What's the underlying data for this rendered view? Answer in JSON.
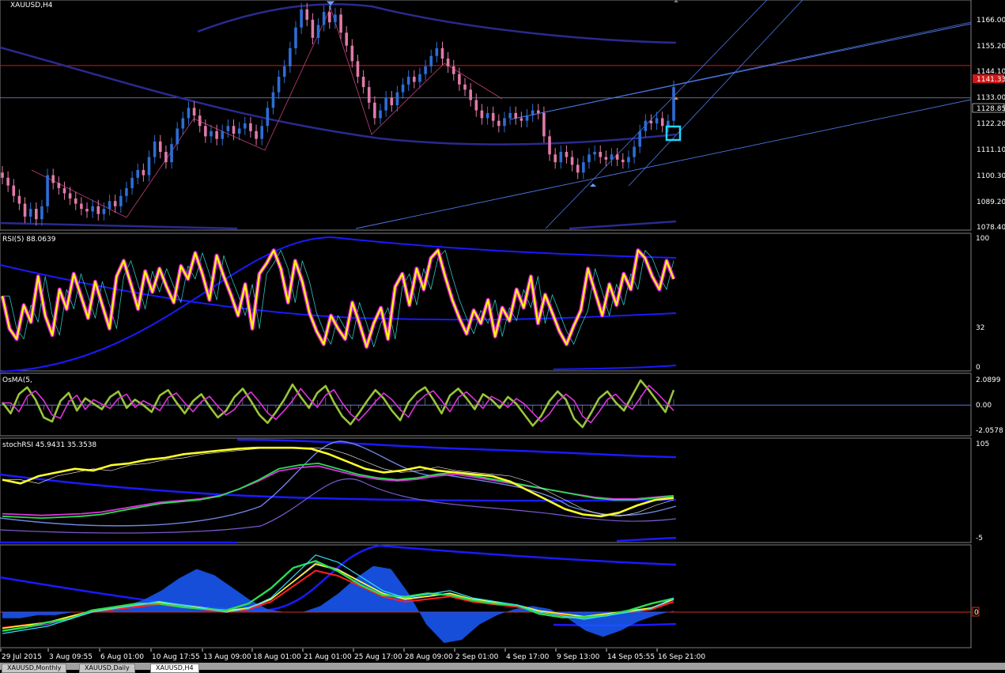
{
  "window": {
    "symbol_title": "XAUUSD,H4",
    "tabs": [
      {
        "label": "XAUUSD,Monthly",
        "active": false
      },
      {
        "label": "XAUUSD,Daily",
        "active": false
      },
      {
        "label": "XAUUSD,H4",
        "active": true
      }
    ]
  },
  "colors": {
    "up_candle": "#2d6dd6",
    "down_candle": "#e07aa8",
    "envelope": "#2a2a8f",
    "hline": "#d01818",
    "channel": "#4d78e8",
    "rsi_main": "#ffff00",
    "rsi_glow": "#e01ee0",
    "osma": "#9ac33a",
    "stoch_yellow": "#ffff2a",
    "stoch_green": "#2adc50",
    "stoch_magenta": "#dd33dd",
    "blue_band": "#1a1aff",
    "hist_blue": "#1a5aff",
    "cyan": "#30e0ff",
    "red": "#ff2020",
    "highlight_box": "#22d8ff"
  },
  "chart_data": [
    {
      "type": "candlestick",
      "title": "XAUUSD,H4",
      "ylim": [
        1078.4,
        1166.0
      ],
      "price_ticks": [
        "1166.00",
        "1155.20",
        "1144.10",
        "1133.00",
        "1122.20",
        "1111.10",
        "1100.30",
        "1089.20",
        "1078.40"
      ],
      "current_price_label": "1141.33",
      "cursor_price_label": "1128.85",
      "horizontal_line": 1141.33,
      "cursor_line": 1128.85,
      "closes": [
        1098,
        1095,
        1091,
        1088,
        1083,
        1086,
        1082,
        1087,
        1099,
        1096,
        1094,
        1092,
        1090,
        1088,
        1086,
        1085,
        1087,
        1084,
        1086,
        1089,
        1087,
        1091,
        1094,
        1098,
        1101,
        1099,
        1106,
        1112,
        1108,
        1104,
        1111,
        1117,
        1121,
        1125,
        1122,
        1118,
        1114,
        1116,
        1113,
        1116,
        1118,
        1115,
        1117,
        1119,
        1116,
        1113,
        1118,
        1125,
        1131,
        1137,
        1141,
        1148,
        1156,
        1163,
        1159,
        1152,
        1157,
        1162,
        1158,
        1161,
        1154,
        1149,
        1143,
        1137,
        1133,
        1127,
        1121,
        1124,
        1129,
        1126,
        1131,
        1134,
        1137,
        1135,
        1138,
        1141,
        1145,
        1148,
        1144,
        1141,
        1138,
        1134,
        1132,
        1128,
        1124,
        1121,
        1123,
        1120,
        1118,
        1121,
        1123,
        1121,
        1120,
        1122,
        1124,
        1123,
        1114,
        1107,
        1104,
        1108,
        1106,
        1103,
        1100,
        1104,
        1107,
        1108,
        1106,
        1105,
        1107,
        1105,
        1104,
        1106,
        1110,
        1116,
        1120,
        1119,
        1121,
        1118,
        1120,
        1133
      ]
    },
    {
      "type": "line",
      "title": "RSI(5) 88.0639",
      "ylim": [
        0,
        100
      ],
      "y_ticks": [
        "100",
        "32",
        "0"
      ],
      "series": [
        {
          "values": [
            55,
            30,
            22,
            48,
            35,
            70,
            40,
            25,
            60,
            45,
            72,
            55,
            38,
            66,
            48,
            30,
            70,
            82,
            64,
            45,
            74,
            58,
            76,
            62,
            50,
            78,
            68,
            88,
            72,
            52,
            86,
            70,
            56,
            40,
            64,
            30,
            72,
            80,
            90,
            76,
            50,
            82,
            66,
            42,
            28,
            18,
            40,
            30,
            22,
            50,
            34,
            16,
            34,
            46,
            22,
            62,
            72,
            48,
            76,
            60,
            84,
            90,
            70,
            52,
            38,
            26,
            44,
            34,
            52,
            24,
            46,
            36,
            60,
            46,
            70,
            34,
            56,
            42,
            28,
            18,
            32,
            44,
            76,
            58,
            40,
            64,
            48,
            72,
            60,
            90,
            84,
            70,
            60,
            82,
            68
          ]
        }
      ]
    },
    {
      "type": "line",
      "title": "OsMA(5,",
      "ylim": [
        -2.0578,
        2.0899
      ],
      "y_ticks": [
        "2.0899",
        "0.00",
        "-2.0578"
      ],
      "series": [
        {
          "values": [
            0.2,
            -0.6,
            0.8,
            1.3,
            0.4,
            -0.9,
            -1.2,
            0.3,
            0.9,
            -0.4,
            0.5,
            0.1,
            -0.3,
            0.6,
            1.0,
            -0.2,
            0.4,
            0.0,
            -0.5,
            0.7,
            1.1,
            0.2,
            -0.6,
            0.3,
            0.8,
            -0.1,
            -0.9,
            -0.4,
            0.6,
            1.2,
            0.3,
            -0.7,
            -1.3,
            -0.5,
            0.4,
            1.5,
            0.6,
            -0.2,
            0.9,
            1.4,
            0.2,
            -0.8,
            -1.4,
            -0.6,
            0.3,
            1.1,
            0.5,
            -0.4,
            -1.1,
            0.2,
            0.9,
            1.3,
            0.4,
            -0.6,
            0.7,
            1.2,
            0.5,
            -0.3,
            0.8,
            0.4,
            -0.2,
            0.6,
            0.1,
            -0.7,
            -1.5,
            -0.8,
            0.3,
            1.0,
            0.4,
            -1.0,
            -1.6,
            -0.6,
            0.5,
            1.0,
            0.2,
            -0.4,
            0.7,
            1.8,
            1.1,
            0.3,
            -0.5,
            1.1
          ]
        }
      ]
    },
    {
      "type": "line",
      "title": "stochRSI 45.9431 35.3538",
      "ylim": [
        -5,
        105
      ],
      "y_ticks": [
        "105",
        "-5"
      ],
      "series": [
        {
          "values": [
            62,
            58,
            66,
            70,
            74,
            72,
            78,
            80,
            84,
            86,
            90,
            92,
            94,
            96,
            97,
            97,
            97,
            96,
            90,
            82,
            74,
            70,
            72,
            76,
            72,
            70,
            68,
            66,
            60,
            50,
            40,
            30,
            24,
            22,
            26,
            34,
            40,
            42
          ]
        },
        {
          "values": [
            22,
            21,
            20,
            21,
            22,
            24,
            28,
            32,
            36,
            38,
            40,
            44,
            52,
            62,
            74,
            78,
            80,
            74,
            68,
            64,
            62,
            64,
            68,
            70,
            66,
            62,
            58,
            54,
            50,
            46,
            42,
            40,
            40,
            42,
            44
          ]
        }
      ]
    },
    {
      "type": "area",
      "title": "",
      "ylim": [
        -1,
        1
      ],
      "series": [
        {
          "values": [
            -0.1,
            -0.1,
            -0.05,
            -0.05,
            0,
            0,
            0.05,
            0.1,
            0.2,
            0.35,
            0.55,
            0.7,
            0.6,
            0.4,
            0.2,
            0.05,
            0,
            0,
            0.1,
            0.3,
            0.55,
            0.75,
            0.7,
            0.3,
            -0.2,
            -0.5,
            -0.45,
            -0.2,
            -0.05,
            0.05,
            0.1,
            0.05,
            -0.1,
            -0.3,
            -0.4,
            -0.3,
            -0.15,
            -0.05,
            0.02
          ]
        },
        {
          "values": [
            -0.3,
            -0.25,
            -0.2,
            -0.1,
            0,
            0.05,
            0.1,
            0.15,
            0.1,
            0.05,
            0,
            0.05,
            0.2,
            0.5,
            0.8,
            0.7,
            0.5,
            0.3,
            0.2,
            0.25,
            0.3,
            0.2,
            0.15,
            0.1,
            0.0,
            -0.05,
            -0.1,
            -0.05,
            0.0,
            0.05,
            0.2
          ]
        }
      ]
    }
  ],
  "time_axis": [
    "29 Jul 2015",
    "3 Aug 09:55",
    "6 Aug 01:00",
    "10 Aug 17:55",
    "13 Aug 09:00",
    "18 Aug 01:00",
    "21 Aug 01:00",
    "25 Aug 17:00",
    "28 Aug 09:00",
    "2 Sep 01:00",
    "4 Sep 17:00",
    "9 Sep 13:00",
    "14 Sep 05:55",
    "16 Sep 21:00"
  ],
  "last_sub_label": "0"
}
